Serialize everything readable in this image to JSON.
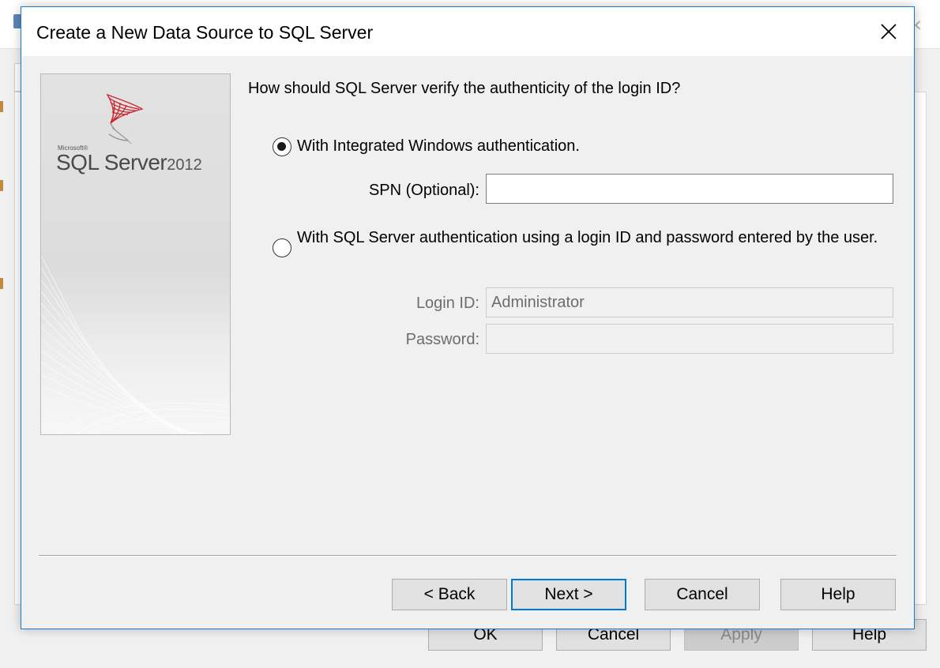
{
  "background_window": {
    "buttons": [
      {
        "label": "OK",
        "enabled": true
      },
      {
        "label": "Cancel",
        "enabled": true
      },
      {
        "label": "Apply",
        "enabled": false
      },
      {
        "label": "Help",
        "enabled": true
      }
    ]
  },
  "dialog": {
    "title": "Create a New Data Source to SQL Server",
    "banner": {
      "brand_small": "Microsoft®",
      "product": "SQL Server",
      "year": "2012"
    },
    "question": "How should SQL Server verify the authenticity of the login ID?",
    "options": [
      {
        "label": "With Integrated Windows authentication.",
        "selected": true
      },
      {
        "label": "With SQL Server authentication using a login ID and password entered by the user.",
        "selected": false
      }
    ],
    "fields": {
      "spn": {
        "label": "SPN (Optional):",
        "value": "",
        "enabled": true
      },
      "login_id": {
        "label": "Login ID:",
        "value": "Administrator",
        "enabled": false
      },
      "password": {
        "label": "Password:",
        "value": "",
        "enabled": false
      }
    },
    "buttons": {
      "back": "< Back",
      "next": "Next >",
      "cancel": "Cancel",
      "help": "Help"
    }
  },
  "colors": {
    "accent": "#0078d7",
    "dialog_border": "#1979ca",
    "logo_red": "#c8262c"
  },
  "icons": {
    "close": "close-icon",
    "logo": "sql-server-logo-icon"
  }
}
